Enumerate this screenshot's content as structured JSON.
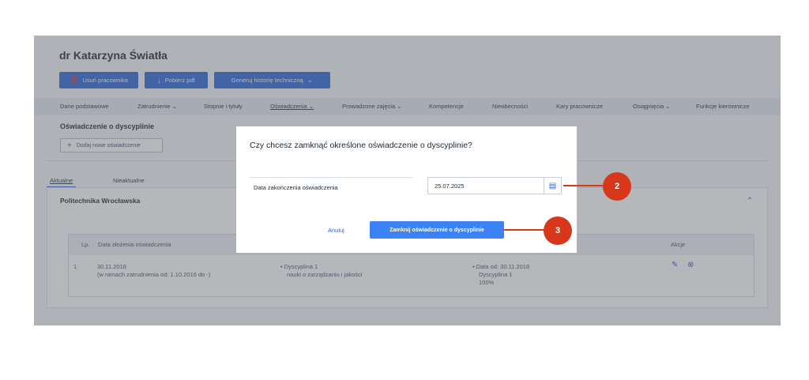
{
  "header": {
    "employee_name": "dr Katarzyna Światła",
    "buttons": {
      "delete": "Usuń pracownika",
      "pdf": "Pobierz pdf",
      "history": "Generuj historię techniczną"
    }
  },
  "tabs": [
    "Dane podstawowe",
    "Zatrudnienie",
    "Stopnie i tytuły",
    "Oświadczenia",
    "Prowadzone zajęcia",
    "Kompetencje",
    "Nieobecności",
    "Kary pracownicze",
    "Osiągnięcia",
    "Funkcje kierownicze"
  ],
  "section": {
    "title": "Oświadczenie o dyscyplinie",
    "add_button": "Dodaj nowe oświadczenie"
  },
  "subtabs": [
    "Aktualne",
    "Nieaktualne"
  ],
  "organization": "Politechnika Wrocławska",
  "table": {
    "headers": {
      "lp": "Lp.",
      "date": "Data złożenia oświadczenia",
      "actions": "Akcje"
    },
    "row": {
      "lp": "1",
      "date": "30.11.2018",
      "employment": "(w ramach zatrudnienia od: 1.10.2016 do -)",
      "discipline_bullet": "•  Dyscyplina 1",
      "discipline_area": "nauki o zarządzaniu i jakości",
      "date_from_bullet": "•  Data od: 30.11.2018",
      "discipline_name": "Dyscyplina 1",
      "percent": "100%"
    }
  },
  "modal": {
    "title": "Czy chcesz zamknąć określone oświadczenie o dyscyplinie?",
    "field_label": "Data zakończenia oświadczenia",
    "date_value": "25.07.2025",
    "cancel": "Anuluj",
    "confirm": "Zamknij oświadczenie o dyscyplinie"
  },
  "callouts": [
    "2",
    "3"
  ]
}
